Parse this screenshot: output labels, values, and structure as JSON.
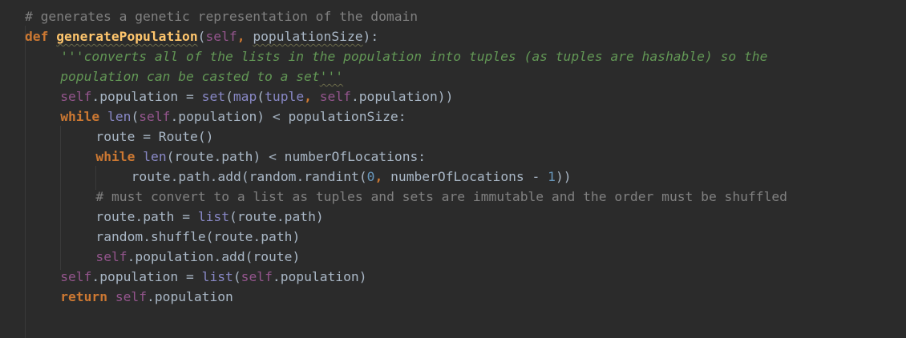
{
  "editor": {
    "lines": [
      {
        "indent": 2,
        "tokens": [
          {
            "t": "# generates a genetic representation of the domain",
            "c": "cmt"
          }
        ]
      },
      {
        "indent": 2,
        "tokens": [
          {
            "t": "def ",
            "c": "kw"
          },
          {
            "t": "generatePopulation",
            "c": "fn wavy"
          },
          {
            "t": "(",
            "c": ""
          },
          {
            "t": "self",
            "c": "self"
          },
          {
            "t": ", ",
            "c": "kw"
          },
          {
            "t": "populationSize",
            "c": "param wavy"
          },
          {
            "t": "):",
            "c": ""
          }
        ]
      },
      {
        "indent": 6,
        "tokens": [
          {
            "t": "'''converts all of the lists in the population into tuples (as tuples are hashable) so the",
            "c": "doc"
          }
        ]
      },
      {
        "indent": 6,
        "tokens": [
          {
            "t": "population can be casted to a set",
            "c": "doc"
          },
          {
            "t": "'''",
            "c": "doc wavy"
          }
        ]
      },
      {
        "indent": 6,
        "tokens": [
          {
            "t": "self",
            "c": "self"
          },
          {
            "t": ".population = ",
            "c": ""
          },
          {
            "t": "set",
            "c": "bi"
          },
          {
            "t": "(",
            "c": ""
          },
          {
            "t": "map",
            "c": "bi"
          },
          {
            "t": "(",
            "c": ""
          },
          {
            "t": "tuple",
            "c": "bi"
          },
          {
            "t": ", ",
            "c": "kw"
          },
          {
            "t": "self",
            "c": "self"
          },
          {
            "t": ".population))",
            "c": ""
          }
        ]
      },
      {
        "indent": 6,
        "tokens": [
          {
            "t": "while ",
            "c": "kw"
          },
          {
            "t": "len",
            "c": "bi"
          },
          {
            "t": "(",
            "c": ""
          },
          {
            "t": "self",
            "c": "self"
          },
          {
            "t": ".population) < populationSize:",
            "c": ""
          }
        ]
      },
      {
        "indent": 10,
        "tokens": [
          {
            "t": "route = Route()",
            "c": ""
          }
        ]
      },
      {
        "indent": 10,
        "tokens": [
          {
            "t": "while ",
            "c": "kw"
          },
          {
            "t": "len",
            "c": "bi"
          },
          {
            "t": "(route.path) < numberOfLocations:",
            "c": ""
          }
        ]
      },
      {
        "indent": 14,
        "tokens": [
          {
            "t": "route.path.add(random.randint(",
            "c": ""
          },
          {
            "t": "0",
            "c": "num"
          },
          {
            "t": ", ",
            "c": "kw"
          },
          {
            "t": "numberOfLocations - ",
            "c": ""
          },
          {
            "t": "1",
            "c": "num"
          },
          {
            "t": "))",
            "c": ""
          }
        ]
      },
      {
        "indent": 10,
        "tokens": [
          {
            "t": "# must convert to a list as tuples and sets are immutable and the order must be shuffled",
            "c": "cmt"
          }
        ]
      },
      {
        "indent": 10,
        "tokens": [
          {
            "t": "route.path = ",
            "c": ""
          },
          {
            "t": "list",
            "c": "bi"
          },
          {
            "t": "(route.path)",
            "c": ""
          }
        ]
      },
      {
        "indent": 10,
        "tokens": [
          {
            "t": "random.shuffle(route.path)",
            "c": ""
          }
        ]
      },
      {
        "indent": 10,
        "tokens": [
          {
            "t": "self",
            "c": "self"
          },
          {
            "t": ".population.add(route)",
            "c": ""
          }
        ]
      },
      {
        "indent": 6,
        "tokens": [
          {
            "t": "self",
            "c": "self"
          },
          {
            "t": ".population = ",
            "c": ""
          },
          {
            "t": "list",
            "c": "bi"
          },
          {
            "t": "(",
            "c": ""
          },
          {
            "t": "self",
            "c": "self"
          },
          {
            "t": ".population)",
            "c": ""
          }
        ]
      },
      {
        "indent": 6,
        "tokens": [
          {
            "t": "return ",
            "c": "kw"
          },
          {
            "t": "self",
            "c": "self"
          },
          {
            "t": ".population",
            "c": ""
          }
        ]
      }
    ]
  }
}
